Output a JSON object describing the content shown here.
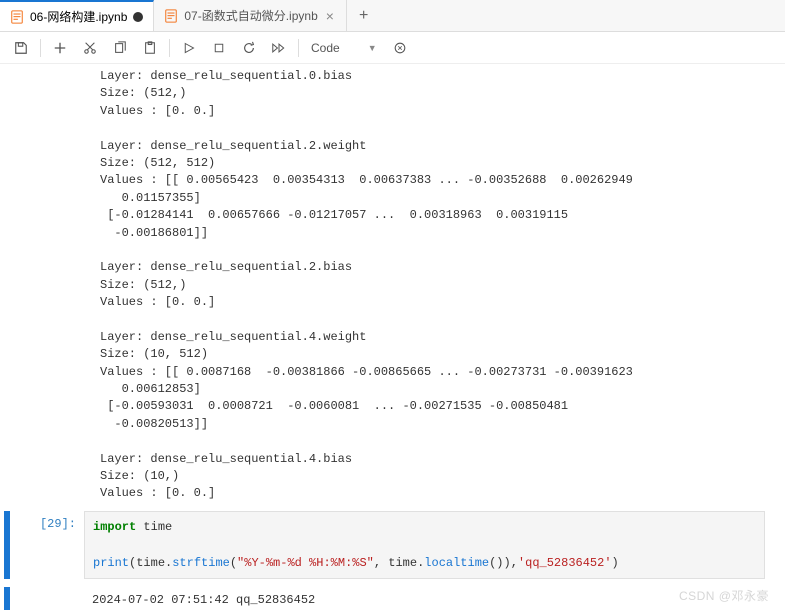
{
  "tabs": {
    "active": {
      "label": "06-网络构建.ipynb"
    },
    "inactive": {
      "label": "07-函数式自动微分.ipynb"
    }
  },
  "toolbar": {
    "cell_type": "Code"
  },
  "output_text": "Layer: dense_relu_sequential.0.bias\nSize: (512,)\nValues : [0. 0.]\n\nLayer: dense_relu_sequential.2.weight\nSize: (512, 512)\nValues : [[ 0.00565423  0.00354313  0.00637383 ... -0.00352688  0.00262949\n   0.01157355]\n [-0.01284141  0.00657666 -0.01217057 ...  0.00318963  0.00319115\n  -0.00186801]]\n\nLayer: dense_relu_sequential.2.bias\nSize: (512,)\nValues : [0. 0.]\n\nLayer: dense_relu_sequential.4.weight\nSize: (10, 512)\nValues : [[ 0.0087168  -0.00381866 -0.00865665 ... -0.00273731 -0.00391623\n   0.00612853]\n [-0.00593031  0.0008721  -0.0060081  ... -0.00271535 -0.00850481\n  -0.00820513]]\n\nLayer: dense_relu_sequential.4.bias\nSize: (10,)\nValues : [0. 0.]\n",
  "code_cell": {
    "prompt": "[29]:",
    "kw_import": "import",
    "mod_time": " time",
    "fn_print": "print",
    "lparen": "(",
    "timecall1": "time.",
    "fn_strftime": "strftime",
    "lparen2": "(",
    "fmt_str": "\"%Y-%m-%d %H:%M:%S\"",
    "comma1": ", time.",
    "fn_localtime": "localtime",
    "paren_close": "()),",
    "qq_str": "'qq_52836452'",
    "rparen": ")"
  },
  "code_output": "2024-07-02 07:51:42 qq_52836452",
  "watermark": "CSDN @邓永豪"
}
